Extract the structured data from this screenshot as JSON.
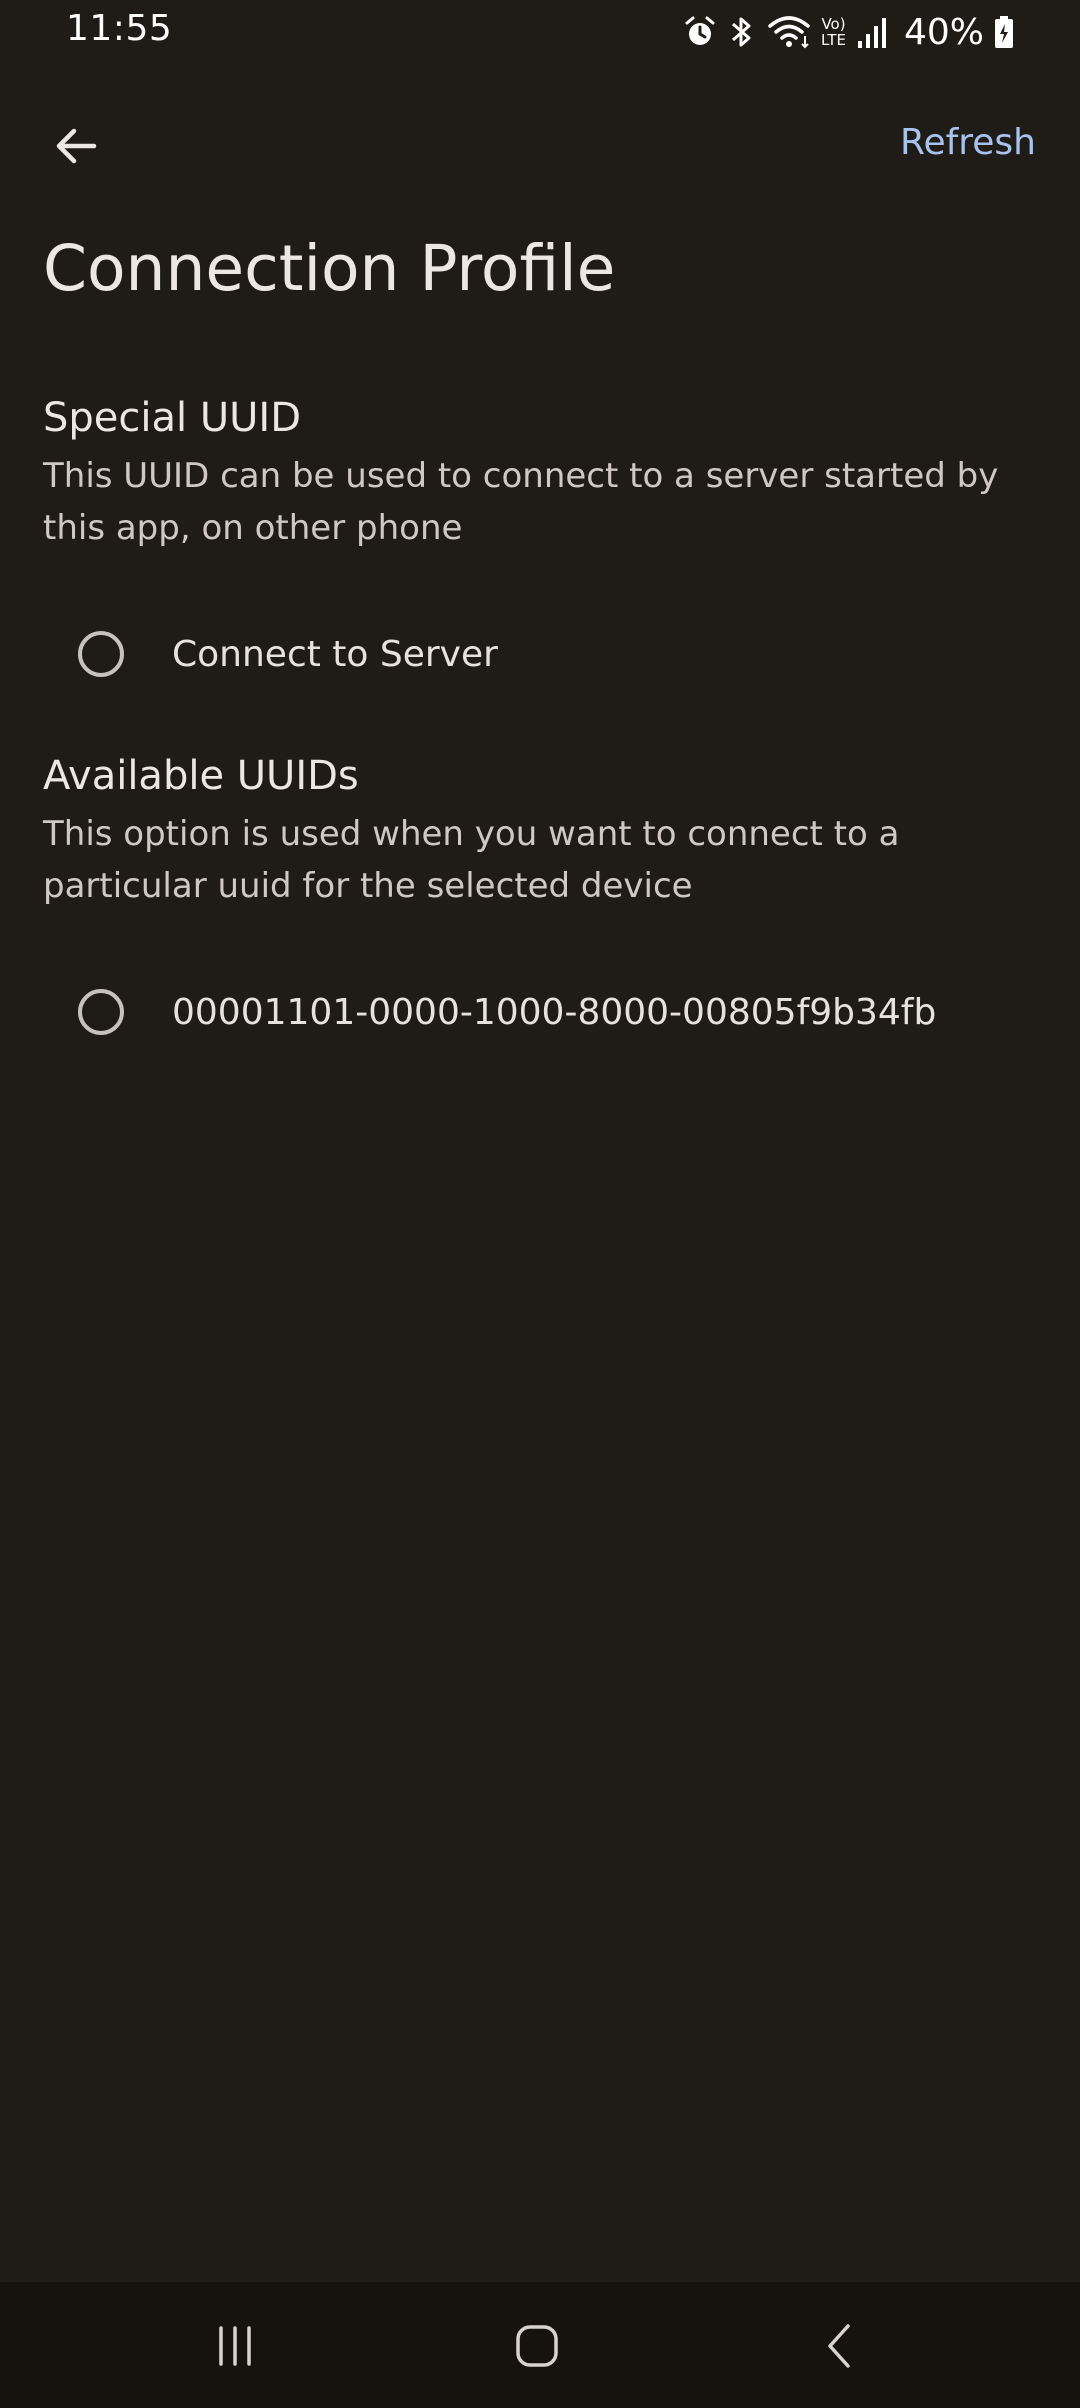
{
  "status_bar": {
    "time": "11:55",
    "battery": "40%",
    "icons": [
      "alarm-icon",
      "bluetooth-icon",
      "wifi-icon",
      "volte-icon",
      "signal-icon",
      "battery-charging-icon"
    ],
    "volte_top": "Vo)",
    "volte_bottom": "LTE"
  },
  "app_bar": {
    "back_icon": "arrow-back-icon",
    "refresh_label": "Refresh"
  },
  "page": {
    "title": "Connection Profile"
  },
  "special_uuid": {
    "title": "Special UUID",
    "description": "This UUID can be used to connect to a server started by this app, on other phone",
    "option_label": "Connect to Server",
    "selected": false
  },
  "available_uuids": {
    "title": "Available UUIDs",
    "description": "This option is used when you want to connect to a particular uuid for the selected device",
    "options": [
      {
        "label": "00001101-0000-1000-8000-00805f9b34fb",
        "selected": false
      }
    ]
  },
  "nav_bar": {
    "icons": [
      "recent-apps-icon",
      "home-icon",
      "back-nav-icon"
    ]
  },
  "colors": {
    "background": "#1f1c18",
    "accent": "#a8c2ee",
    "text": "#ece7e0"
  }
}
